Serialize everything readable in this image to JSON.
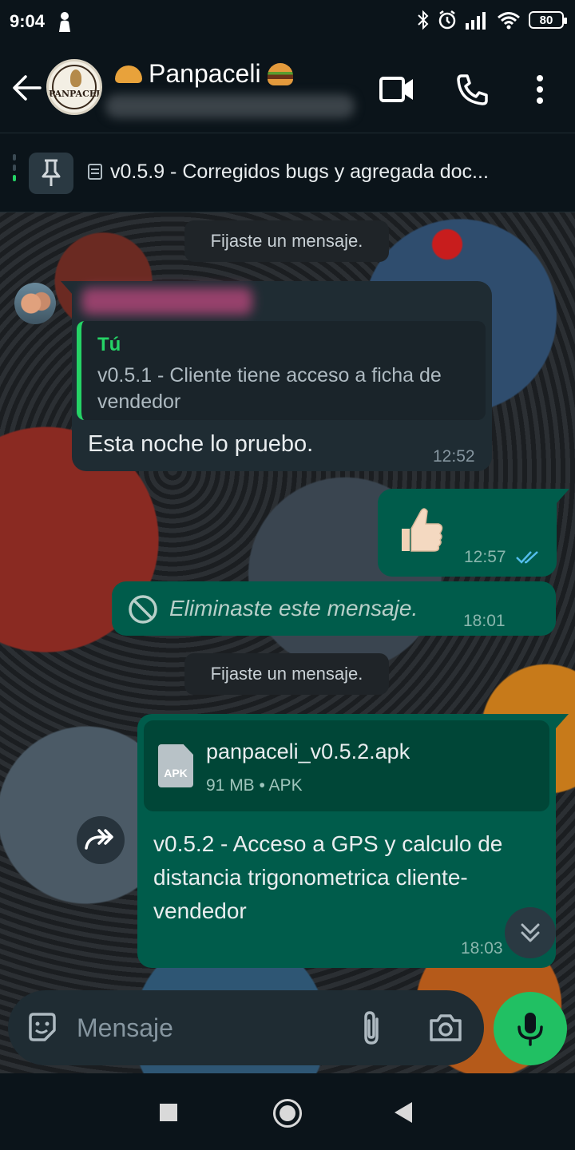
{
  "status_bar": {
    "time": "9:04",
    "battery": "80"
  },
  "header": {
    "title": "Panpaceli",
    "avatar_logo_text": "PANPACELI",
    "icons": [
      "back-arrow-icon",
      "video-call-icon",
      "phone-icon",
      "more-vert-icon"
    ]
  },
  "pinned": {
    "text": "v0.5.9 - Corregidos bugs y agregada doc..."
  },
  "messages": {
    "system_1": "Fijaste un mensaje.",
    "incoming": {
      "quote_name": "Tú",
      "quote_text": "v0.5.1 - Cliente tiene acceso a ficha de vendedor",
      "text": "Esta noche lo pruebo.",
      "time": "12:52"
    },
    "outgoing_thumb": {
      "time": "12:57"
    },
    "deleted": {
      "text": "Eliminaste este mensaje.",
      "time": "18:01"
    },
    "system_2": "Fijaste un mensaje.",
    "file": {
      "name": "panpaceli_v0.5.2.apk",
      "meta": "91 MB • APK",
      "badge": "APK",
      "caption": "v0.5.2 - Acceso a GPS y calculo de distancia trigonometrica cliente-vendedor",
      "time": "18:03"
    }
  },
  "composer": {
    "placeholder": "Mensaje"
  },
  "colors": {
    "accent": "#25d366",
    "outgoing_bubble": "#005c4b",
    "incoming_bubble": "#1f2c33",
    "background": "#0b141a"
  }
}
